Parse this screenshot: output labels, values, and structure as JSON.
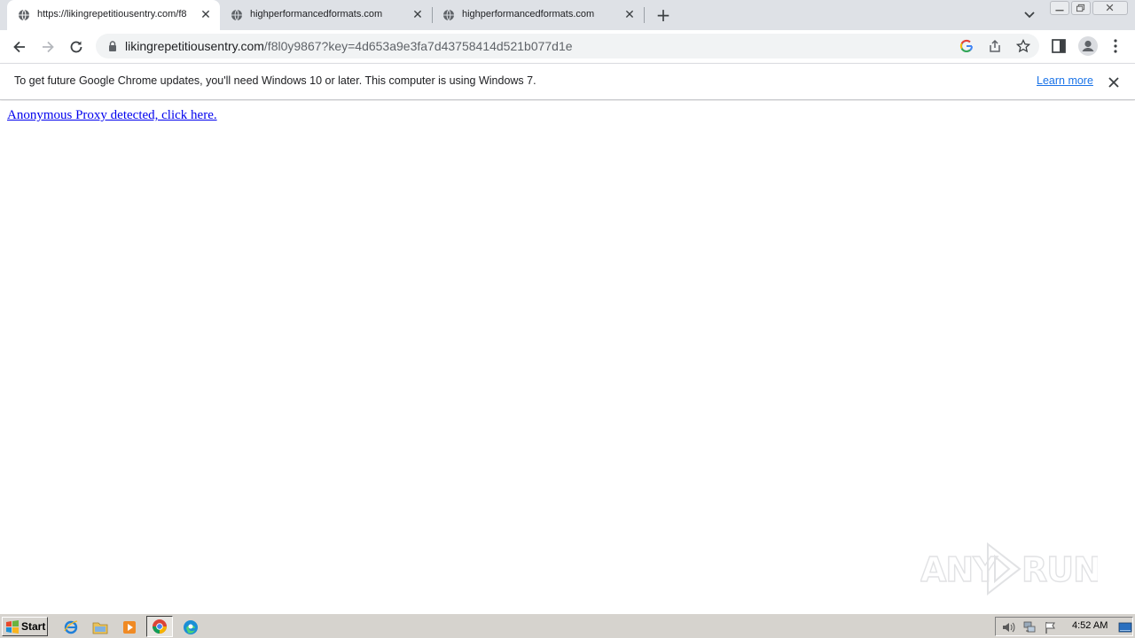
{
  "browser": {
    "tabs": [
      {
        "title": "https://likingrepetitiousentry.com/f8",
        "active": true
      },
      {
        "title": "highperformancedformats.com",
        "active": false
      },
      {
        "title": "highperformancedformats.com",
        "active": false
      }
    ],
    "url_host": "likingrepetitiousentry.com",
    "url_path": "/f8l0y9867?key=4d653a9e3fa7d43758414d521b077d1e"
  },
  "infobar": {
    "message": "To get future Google Chrome updates, you'll need Windows 10 or later. This computer is using Windows 7.",
    "link": "Learn more"
  },
  "page": {
    "link_text": "Anonymous Proxy detected, click here."
  },
  "watermark": {
    "text_left": "ANY",
    "text_right": "RUN"
  },
  "taskbar": {
    "start_label": "Start",
    "clock": "4:52 AM"
  },
  "colors": {
    "tabstrip": "#dee1e6",
    "link": "#0000ee",
    "chrome_link": "#1a73e8",
    "taskbar": "#d6d3ce"
  }
}
